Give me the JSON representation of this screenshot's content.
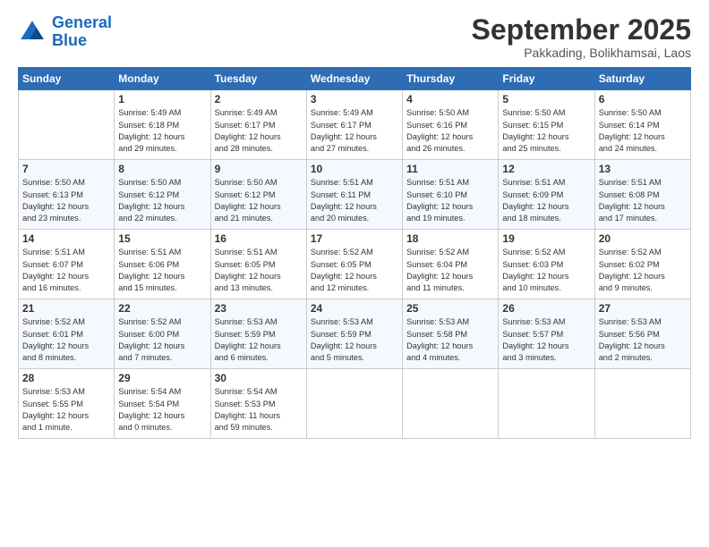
{
  "header": {
    "logo_line1": "General",
    "logo_line2": "Blue",
    "month": "September 2025",
    "location": "Pakkading, Bolikhamsai, Laos"
  },
  "days_of_week": [
    "Sunday",
    "Monday",
    "Tuesday",
    "Wednesday",
    "Thursday",
    "Friday",
    "Saturday"
  ],
  "weeks": [
    [
      {
        "num": "",
        "info": ""
      },
      {
        "num": "1",
        "info": "Sunrise: 5:49 AM\nSunset: 6:18 PM\nDaylight: 12 hours\nand 29 minutes."
      },
      {
        "num": "2",
        "info": "Sunrise: 5:49 AM\nSunset: 6:17 PM\nDaylight: 12 hours\nand 28 minutes."
      },
      {
        "num": "3",
        "info": "Sunrise: 5:49 AM\nSunset: 6:17 PM\nDaylight: 12 hours\nand 27 minutes."
      },
      {
        "num": "4",
        "info": "Sunrise: 5:50 AM\nSunset: 6:16 PM\nDaylight: 12 hours\nand 26 minutes."
      },
      {
        "num": "5",
        "info": "Sunrise: 5:50 AM\nSunset: 6:15 PM\nDaylight: 12 hours\nand 25 minutes."
      },
      {
        "num": "6",
        "info": "Sunrise: 5:50 AM\nSunset: 6:14 PM\nDaylight: 12 hours\nand 24 minutes."
      }
    ],
    [
      {
        "num": "7",
        "info": "Sunrise: 5:50 AM\nSunset: 6:13 PM\nDaylight: 12 hours\nand 23 minutes."
      },
      {
        "num": "8",
        "info": "Sunrise: 5:50 AM\nSunset: 6:12 PM\nDaylight: 12 hours\nand 22 minutes."
      },
      {
        "num": "9",
        "info": "Sunrise: 5:50 AM\nSunset: 6:12 PM\nDaylight: 12 hours\nand 21 minutes."
      },
      {
        "num": "10",
        "info": "Sunrise: 5:51 AM\nSunset: 6:11 PM\nDaylight: 12 hours\nand 20 minutes."
      },
      {
        "num": "11",
        "info": "Sunrise: 5:51 AM\nSunset: 6:10 PM\nDaylight: 12 hours\nand 19 minutes."
      },
      {
        "num": "12",
        "info": "Sunrise: 5:51 AM\nSunset: 6:09 PM\nDaylight: 12 hours\nand 18 minutes."
      },
      {
        "num": "13",
        "info": "Sunrise: 5:51 AM\nSunset: 6:08 PM\nDaylight: 12 hours\nand 17 minutes."
      }
    ],
    [
      {
        "num": "14",
        "info": "Sunrise: 5:51 AM\nSunset: 6:07 PM\nDaylight: 12 hours\nand 16 minutes."
      },
      {
        "num": "15",
        "info": "Sunrise: 5:51 AM\nSunset: 6:06 PM\nDaylight: 12 hours\nand 15 minutes."
      },
      {
        "num": "16",
        "info": "Sunrise: 5:51 AM\nSunset: 6:05 PM\nDaylight: 12 hours\nand 13 minutes."
      },
      {
        "num": "17",
        "info": "Sunrise: 5:52 AM\nSunset: 6:05 PM\nDaylight: 12 hours\nand 12 minutes."
      },
      {
        "num": "18",
        "info": "Sunrise: 5:52 AM\nSunset: 6:04 PM\nDaylight: 12 hours\nand 11 minutes."
      },
      {
        "num": "19",
        "info": "Sunrise: 5:52 AM\nSunset: 6:03 PM\nDaylight: 12 hours\nand 10 minutes."
      },
      {
        "num": "20",
        "info": "Sunrise: 5:52 AM\nSunset: 6:02 PM\nDaylight: 12 hours\nand 9 minutes."
      }
    ],
    [
      {
        "num": "21",
        "info": "Sunrise: 5:52 AM\nSunset: 6:01 PM\nDaylight: 12 hours\nand 8 minutes."
      },
      {
        "num": "22",
        "info": "Sunrise: 5:52 AM\nSunset: 6:00 PM\nDaylight: 12 hours\nand 7 minutes."
      },
      {
        "num": "23",
        "info": "Sunrise: 5:53 AM\nSunset: 5:59 PM\nDaylight: 12 hours\nand 6 minutes."
      },
      {
        "num": "24",
        "info": "Sunrise: 5:53 AM\nSunset: 5:59 PM\nDaylight: 12 hours\nand 5 minutes."
      },
      {
        "num": "25",
        "info": "Sunrise: 5:53 AM\nSunset: 5:58 PM\nDaylight: 12 hours\nand 4 minutes."
      },
      {
        "num": "26",
        "info": "Sunrise: 5:53 AM\nSunset: 5:57 PM\nDaylight: 12 hours\nand 3 minutes."
      },
      {
        "num": "27",
        "info": "Sunrise: 5:53 AM\nSunset: 5:56 PM\nDaylight: 12 hours\nand 2 minutes."
      }
    ],
    [
      {
        "num": "28",
        "info": "Sunrise: 5:53 AM\nSunset: 5:55 PM\nDaylight: 12 hours\nand 1 minute."
      },
      {
        "num": "29",
        "info": "Sunrise: 5:54 AM\nSunset: 5:54 PM\nDaylight: 12 hours\nand 0 minutes."
      },
      {
        "num": "30",
        "info": "Sunrise: 5:54 AM\nSunset: 5:53 PM\nDaylight: 11 hours\nand 59 minutes."
      },
      {
        "num": "",
        "info": ""
      },
      {
        "num": "",
        "info": ""
      },
      {
        "num": "",
        "info": ""
      },
      {
        "num": "",
        "info": ""
      }
    ]
  ]
}
